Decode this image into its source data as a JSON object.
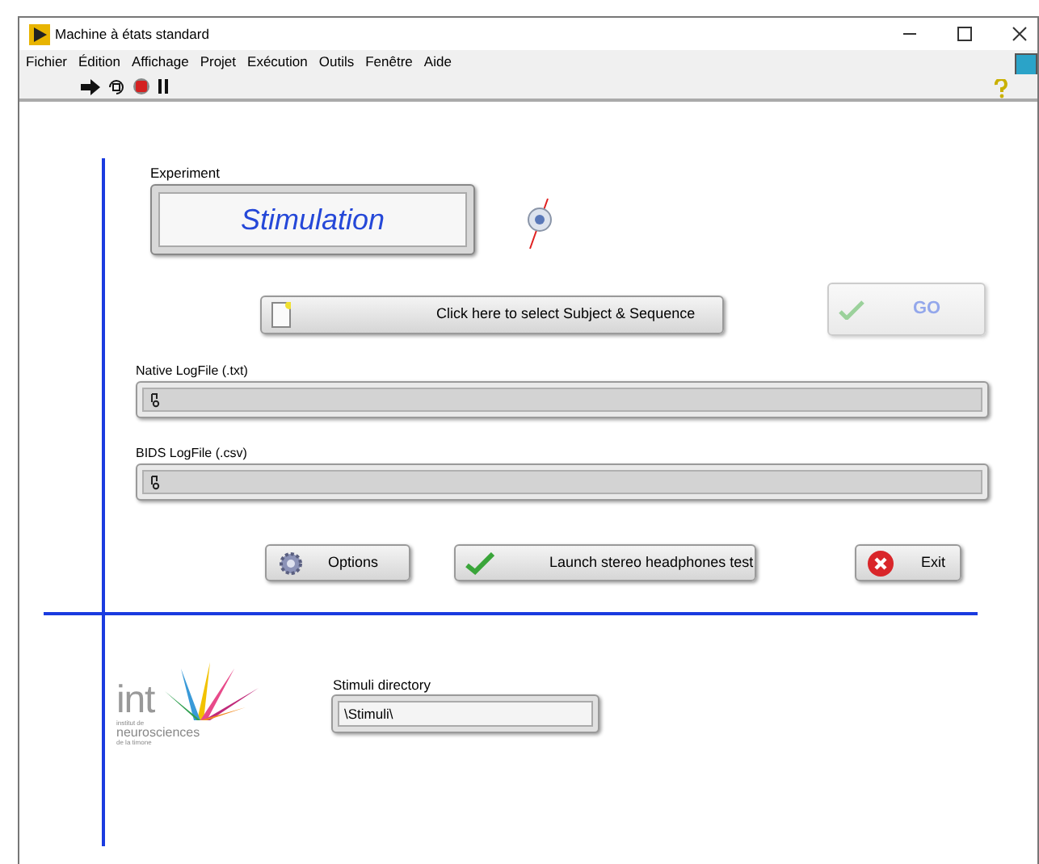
{
  "window": {
    "title": "Machine à états standard"
  },
  "menu": [
    "Fichier",
    "Édition",
    "Affichage",
    "Projet",
    "Exécution",
    "Outils",
    "Fenêtre",
    "Aide"
  ],
  "experiment": {
    "label": "Experiment",
    "value": "Stimulation"
  },
  "select_button": {
    "label": "Click here to select Subject & Sequence"
  },
  "go_button": {
    "label": "GO",
    "disabled": true
  },
  "native_log": {
    "label": "Native LogFile (.txt)"
  },
  "bids_log": {
    "label": "BIDS LogFile (.csv)"
  },
  "buttons": [
    {
      "kind": "options",
      "label": "Options"
    },
    {
      "kind": "test",
      "label": "Launch stereo headphones test"
    },
    {
      "kind": "exit",
      "label": "Exit"
    }
  ],
  "logo": {
    "name": "int",
    "lines": [
      "institut de",
      "neurosciences",
      "de la timone"
    ]
  },
  "stimuli": {
    "label": "Stimuli directory",
    "value": "\\Stimuli\\"
  }
}
